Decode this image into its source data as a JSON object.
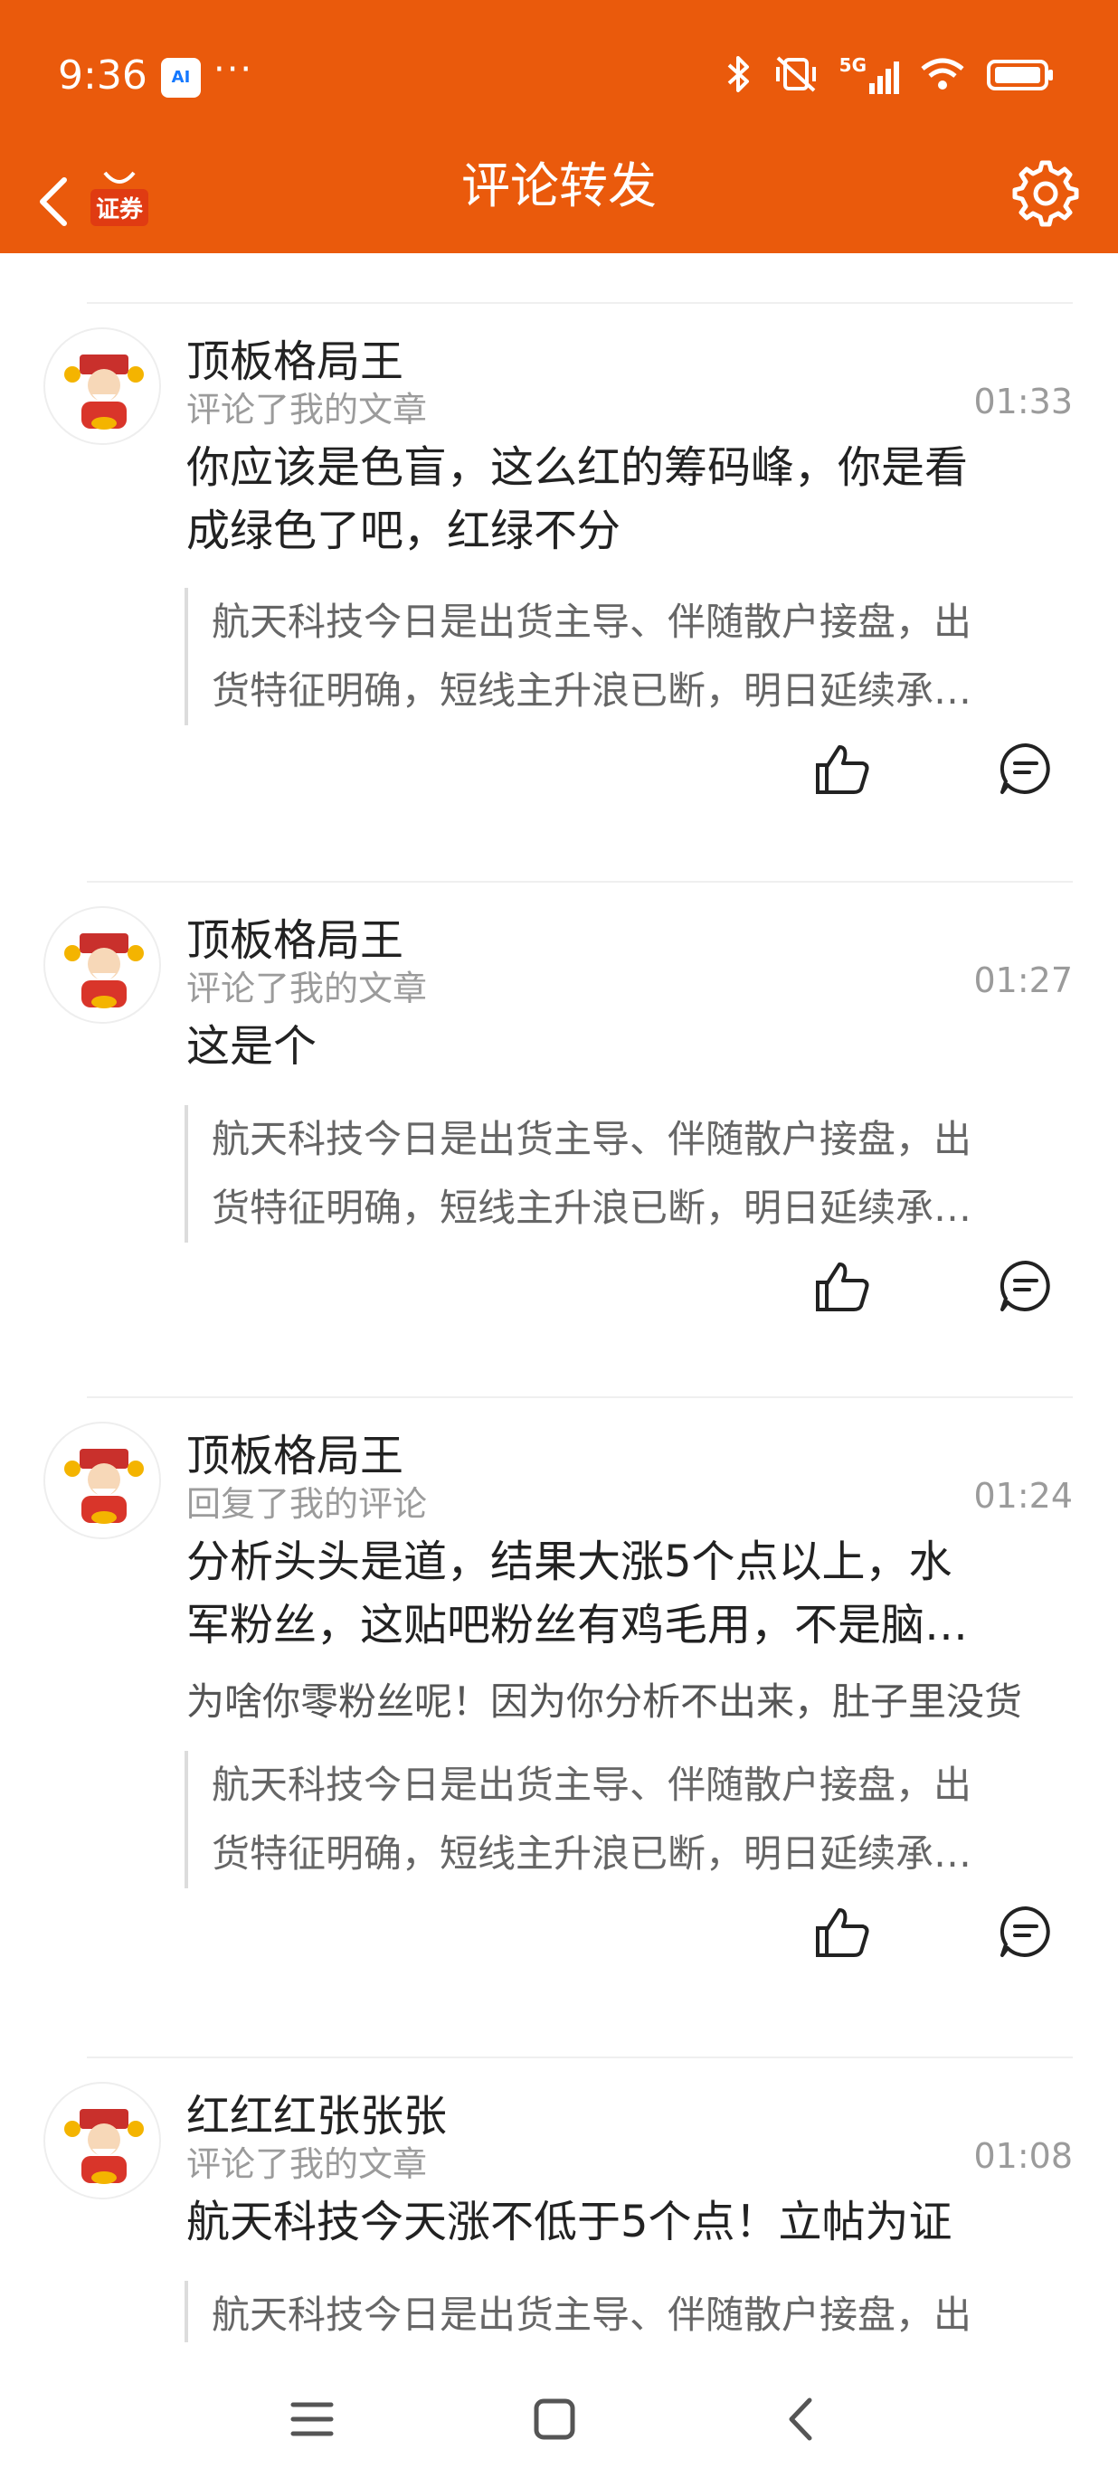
{
  "status_bar": {
    "time": "9:36",
    "ai_badge": "AI标签",
    "dots": "···",
    "network": "5G"
  },
  "header": {
    "title": "评论转发",
    "logo_text": "证券"
  },
  "theme": {
    "accent": "#ea5a0c"
  },
  "items": [
    {
      "user": "顶板格局王",
      "action": "评论了我的文章",
      "time": "01:33",
      "comment_lines": [
        "你应该是色盲，这么红的筹码峰，你是看",
        "成绿色了吧，红绿不分"
      ],
      "reply": "",
      "quote_lines": [
        "航天科技今日是出货主导、伴随散户接盘，出",
        "货特征明确，短线主升浪已断，明日延续承…"
      ]
    },
    {
      "user": "顶板格局王",
      "action": "评论了我的文章",
      "time": "01:27",
      "comment_lines": [
        "这是个"
      ],
      "reply": "",
      "quote_lines": [
        "航天科技今日是出货主导、伴随散户接盘，出",
        "货特征明确，短线主升浪已断，明日延续承…"
      ]
    },
    {
      "user": "顶板格局王",
      "action": "回复了我的评论",
      "time": "01:24",
      "comment_lines": [
        "分析头头是道，结果大涨5个点以上，水",
        "军粉丝，这贴吧粉丝有鸡毛用，不是脑…"
      ],
      "reply": "为啥你零粉丝呢！因为你分析不出来，肚子里没货",
      "quote_lines": [
        "航天科技今日是出货主导、伴随散户接盘，出",
        "货特征明确，短线主升浪已断，明日延续承…"
      ]
    },
    {
      "user": "红红红张张张",
      "action": "评论了我的文章",
      "time": "01:08",
      "comment_lines": [
        "航天科技今天涨不低于5个点！立帖为证"
      ],
      "reply": "",
      "quote_lines": [
        "航天科技今日是出货主导、伴随散户接盘，出"
      ]
    }
  ]
}
